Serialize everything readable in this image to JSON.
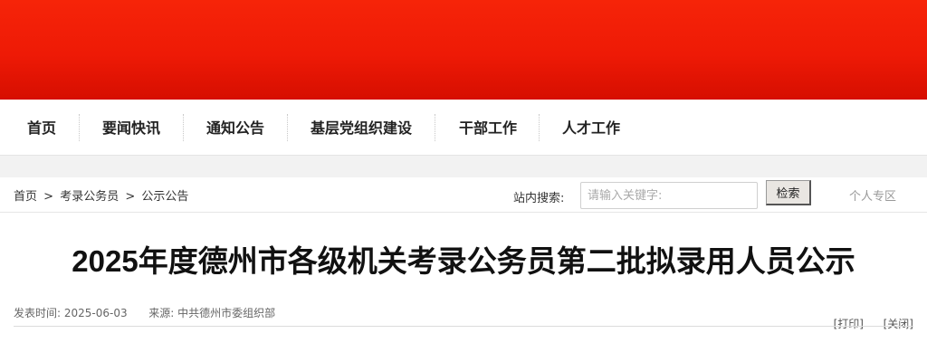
{
  "nav": {
    "items": [
      "首页",
      "要闻快讯",
      "通知公告",
      "基层党组织建设",
      "干部工作",
      "人才工作"
    ]
  },
  "breadcrumb": {
    "items": [
      "首页",
      "考录公务员",
      "公示公告"
    ],
    "separator": ">"
  },
  "search": {
    "label": "站内搜索:",
    "placeholder": "请输入关键字:",
    "button": "检索"
  },
  "personal_link": "个人专区",
  "article": {
    "title": "2025年度德州市各级机关考录公务员第二批拟录用人员公示",
    "published_label": "发表时间:",
    "published_date": "2025-06-03",
    "source_label": "来源:",
    "source": "中共德州市委组织部",
    "print": "[打印]",
    "close": "[关闭]"
  },
  "colors": {
    "banner": "#ee1a06",
    "nav_text": "#222222"
  }
}
